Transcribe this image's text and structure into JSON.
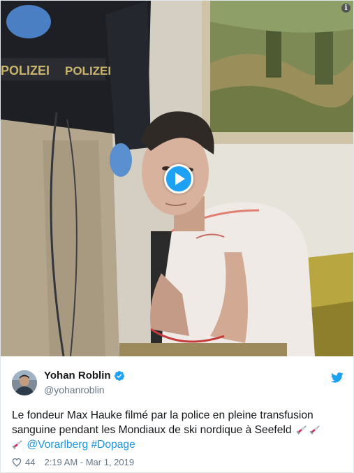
{
  "tweet": {
    "author": {
      "display_name": "Yohan Roblin",
      "handle": "@yohanroblin",
      "verified": true,
      "avatar_icon": "avatar-photo"
    },
    "text": {
      "body": "Le fondeur Max Hauke filmé par la police en pleine transfusion sanguine pendant les Mondiaux de ski nordique à Seefeld ",
      "hashtag_mention": "@Vorarlberg",
      "hashtag": "#Dopage",
      "emoji_icon": "syringe-icon"
    },
    "media": {
      "type": "video",
      "vest_text_1": "POLIZEI",
      "vest_text_2": "POLIZEI",
      "play_icon": "play-icon",
      "info_icon": "info-icon"
    },
    "footer": {
      "like_count": "44",
      "timestamp": "2:19 AM - Mar 1, 2019"
    },
    "colors": {
      "accent": "#1da1f2",
      "link": "#1b95e0",
      "muted": "#657786",
      "text": "#14171a",
      "syringe_red": "#e0245e"
    }
  }
}
